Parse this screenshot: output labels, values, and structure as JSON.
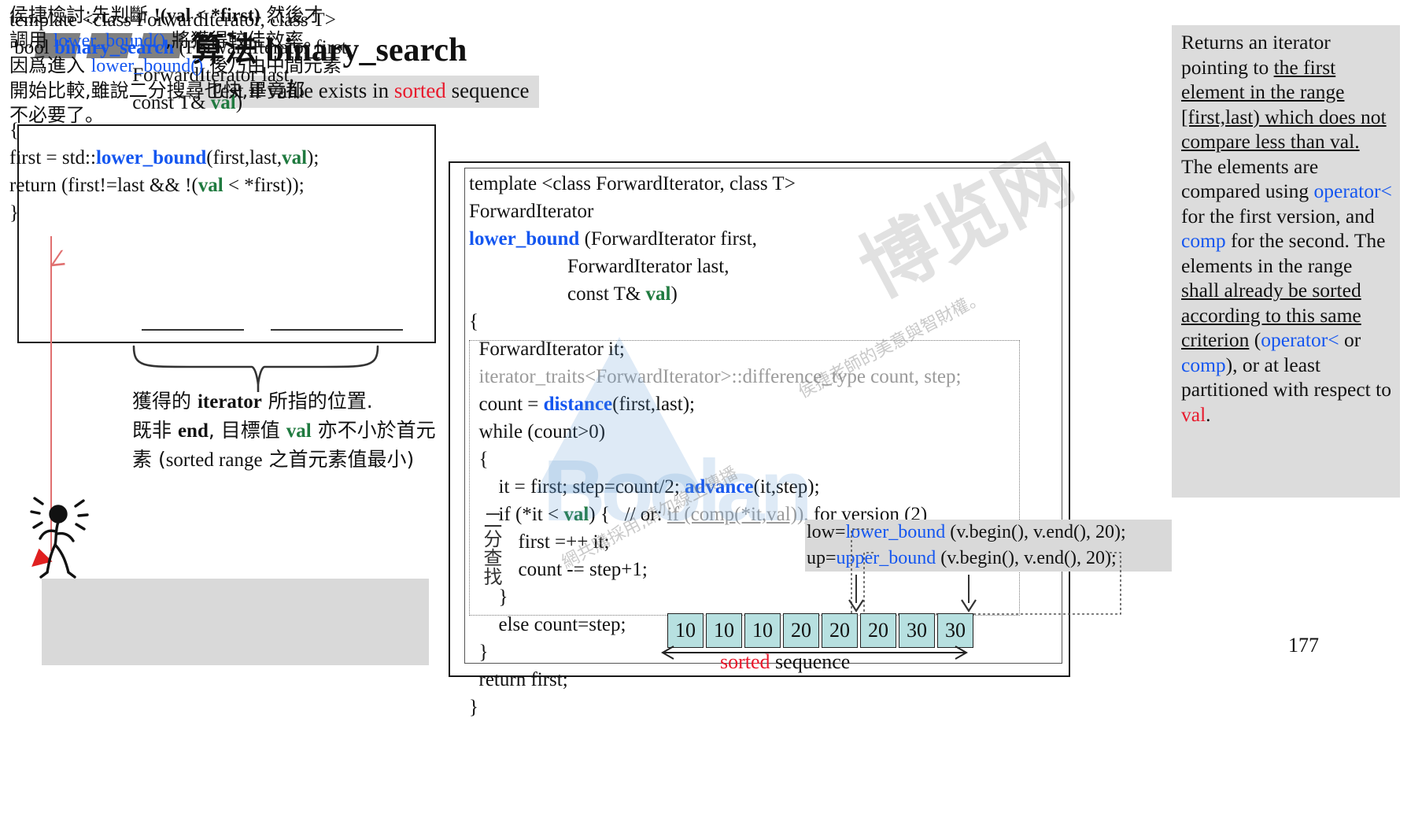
{
  "header": {
    "title_cjk": "算法",
    "title_code": "binary_search",
    "subtitle_pre": "Test if value exists in ",
    "subtitle_hl": "sorted",
    "subtitle_post": " sequence"
  },
  "left_code": {
    "line1": "template <class ForwardIterator, class T>",
    "line2_pre": " bool ",
    "line2_fn": "binary_search",
    "line2_post": " (ForwardIterator first,",
    "line3": "                         ForwardIterator last,",
    "line4_pre": "                         const T& ",
    "line4_val": "val",
    "line4_post": ")",
    "line5": "{",
    "line6_pre": "first = std::",
    "line6_fn": "lower_bound",
    "line6_mid": "(first,last,",
    "line6_val": "val",
    "line6_post": ");",
    "line7_pre": "return (first!=last && !(",
    "line7_val": "val",
    "line7_post": " < *first));",
    "line8": "}"
  },
  "left_note": {
    "l1_a": "獲得的 ",
    "l1_b": "iterator",
    "l1_c": " 所指的位置.",
    "l2_a": "既非 ",
    "l2_b": "end",
    "l2_c": ", 目標值 ",
    "l2_val": "val",
    "l2_d": " 亦不小於首元",
    "l3_a": "素 (",
    "l3_b": "sorted range",
    "l3_c": " 之首元素值最小)"
  },
  "comment_box": {
    "l1_a": "侯捷檢討:先判斷 ",
    "l1_b": "!(val < *first)",
    "l1_c": " 然後才",
    "l2_a": "調用 ",
    "l2_b": "lower_bound()",
    "l2_c": ",將獲得較佳效率。",
    "l3_a": "因爲進入 ",
    "l3_b": "lower_bound()",
    "l3_c": " 後乃由中間元素",
    "l4": "開始比較,雖說二分搜尋也快,畢竟都",
    "l5": "不必要了。"
  },
  "mid_code": {
    "l1": "template <class ForwardIterator, class T>",
    "l2": "ForwardIterator",
    "l3_fn": "lower_bound",
    "l3_post": " (ForwardIterator first,",
    "l4": "                    ForwardIterator last,",
    "l5_pre": "                    const T& ",
    "l5_val": "val",
    "l5_post": ")",
    "l6": "{",
    "l7": "  ForwardIterator it;",
    "l8": "  iterator_traits<ForwardIterator>::difference_type count, step;",
    "l9_pre": "  count = ",
    "l9_fn": "distance",
    "l9_post": "(first,last);",
    "l10": "  while (count>0)",
    "l11": "  {",
    "l12_pre": "      it = first; step=count/2; ",
    "l12_fn": "advance",
    "l12_post": "(it,step);",
    "l13_pre": "      if (*it < ",
    "l13_val": "val",
    "l13_mid": ") {   // or: ",
    "l13_cmt": "if (comp(*it,val)),",
    "l13_post": " for version (2)",
    "l14": "          first =++ it;",
    "l15": "          count -= step+1;",
    "l16": "      }",
    "l17": "      else count=step;",
    "l18": "  }",
    "l19": "  return first;",
    "l20": "}"
  },
  "vertical_cjk": "二分查找",
  "right_panel": {
    "t1": "Returns an iterator pointing to ",
    "u1": "the first element in the range [first,last) which does not compare less than val.",
    "t2": " The elements are compared using ",
    "op1": "operator<",
    "t3": " for the first version, and ",
    "op2": "comp",
    "t4": " for the second. The elements in the range ",
    "u2": "shall already be sorted according to this same criterion",
    "t5": " (",
    "op3": "operator<",
    "t6": " or ",
    "op4": "comp",
    "t7": "), or at least partitioned with respect to ",
    "val": "val",
    "t8": "."
  },
  "lowup": {
    "low_pre": "low=",
    "low_fn": "lower_bound",
    "low_post": " (v.begin(), v.end(), 20);",
    "up_pre": "up=",
    "up_fn": "upper_bound",
    "up_post": " (v.begin(), v.end(), 20);"
  },
  "array": {
    "values": [
      "10",
      "10",
      "10",
      "20",
      "20",
      "20",
      "30",
      "30"
    ],
    "label_hl": "sorted",
    "label_rest": " sequence"
  },
  "page_number": "177",
  "colors": {
    "accent_blue": "#1456f0",
    "accent_red": "#e8192c",
    "accent_green": "#1f7a3f",
    "cell_fill": "#b7e0e0",
    "panel_gray": "#dcdcdc"
  }
}
